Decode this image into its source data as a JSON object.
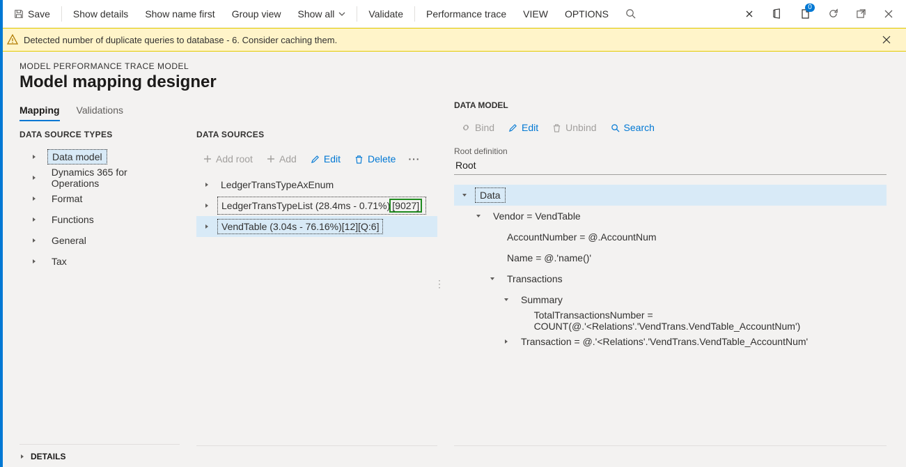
{
  "toolbar": {
    "save": "Save",
    "show_details": "Show details",
    "show_name_first": "Show name first",
    "group_view": "Group view",
    "show_all": "Show all",
    "validate": "Validate",
    "performance_trace": "Performance trace",
    "view": "VIEW",
    "options": "OPTIONS",
    "doc_badge": "0"
  },
  "banner": {
    "message": "Detected number of duplicate queries to database - 6. Consider caching them."
  },
  "breadcrumb": "MODEL PERFORMANCE TRACE MODEL",
  "page_title": "Model mapping designer",
  "tabs": {
    "mapping": "Mapping",
    "validations": "Validations"
  },
  "panes": {
    "types_title": "DATA SOURCE TYPES",
    "sources_title": "DATA SOURCES",
    "data_model_title": "DATA MODEL"
  },
  "types_tree": [
    "Data model",
    "Dynamics 365 for Operations",
    "Format",
    "Functions",
    "General",
    "Tax"
  ],
  "ds_toolbar": {
    "add_root": "Add root",
    "add": "Add",
    "edit": "Edit",
    "delete": "Delete"
  },
  "ds_tree": {
    "row0": "LedgerTransTypeAxEnum",
    "row1_main": "LedgerTransTypeList (28.4ms - 0.71%)",
    "row1_suffix": "[9027]",
    "row2": "VendTable (3.04s - 76.16%)[12][Q:6]"
  },
  "dm_toolbar": {
    "bind": "Bind",
    "edit": "Edit",
    "unbind": "Unbind",
    "search": "Search"
  },
  "root_definition": {
    "label": "Root definition",
    "value": "Root"
  },
  "dm_tree": {
    "n0": "Data",
    "n1": "Vendor = VendTable",
    "n2": "AccountNumber = @.AccountNum",
    "n3": "Name = @.'name()'",
    "n4": "Transactions",
    "n5": "Summary",
    "n6": "TotalTransactionsNumber = COUNT(@.'<Relations'.'VendTrans.VendTable_AccountNum')",
    "n7": "Transaction = @.'<Relations'.'VendTrans.VendTable_AccountNum'"
  },
  "details": "DETAILS"
}
